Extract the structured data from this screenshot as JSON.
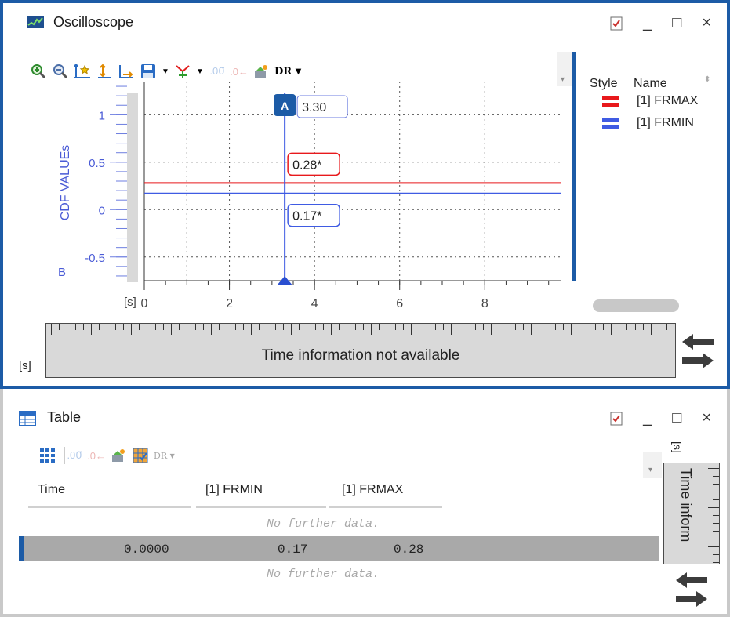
{
  "oscilloscope": {
    "title": "Oscilloscope",
    "window_buttons": {
      "restore_icon": "restore-checkbox-icon",
      "minimize": "_",
      "maximize": "□",
      "close": "×"
    },
    "toolbar": {
      "icons": [
        "zoom-in-icon",
        "zoom-out-icon",
        "zoom-fit-icon",
        "zoom-y-icon",
        "zoom-x-icon",
        "save-icon",
        "cursor-icon",
        "decimals-increase-icon",
        "decimals-decrease-icon",
        "export-icon"
      ],
      "dr_label": "DR"
    },
    "legend": {
      "style_header": "Style",
      "name_header": "Name",
      "items": [
        {
          "name": "[1] FRMAX",
          "color": "#e8191c"
        },
        {
          "name": "[1] FRMIN",
          "color": "#3f5be3"
        }
      ]
    },
    "time_ruler": {
      "unit": "[s]",
      "message": "Time information not available"
    }
  },
  "chart_data": {
    "type": "line",
    "ylabel": "CDF VALUEs",
    "xunit": "[s]",
    "xlim": [
      0,
      9.8
    ],
    "ylim": [
      -0.75,
      1.35
    ],
    "x_ticks": [
      "0",
      "2",
      "4",
      "6",
      "8"
    ],
    "y_ticks": [
      "1",
      "0.5",
      "0",
      "-0.5"
    ],
    "series": [
      {
        "name": "[1] FRMAX",
        "color": "#e8191c",
        "x": [
          0,
          9.8
        ],
        "y": [
          0.28,
          0.28
        ]
      },
      {
        "name": "[1] FRMIN",
        "color": "#3f5be3",
        "x": [
          0,
          9.8
        ],
        "y": [
          0.17,
          0.17
        ]
      }
    ],
    "cursor": {
      "label": "A",
      "x_label": "3.30",
      "x": 3.3,
      "values": [
        "0.28*",
        "0.17*"
      ]
    },
    "marker_b": "B",
    "grid": true
  },
  "table": {
    "title": "Table",
    "dr_label": "DR",
    "columns": [
      "Time",
      "[1] FRMIN",
      "[1] FRMAX"
    ],
    "no_data_top": "No further data.",
    "rows": [
      [
        "0.0000",
        "0.17",
        "0.28"
      ]
    ],
    "no_data_bottom": "No further data.",
    "side_unit": "[s]",
    "side_label": "Time inform"
  }
}
